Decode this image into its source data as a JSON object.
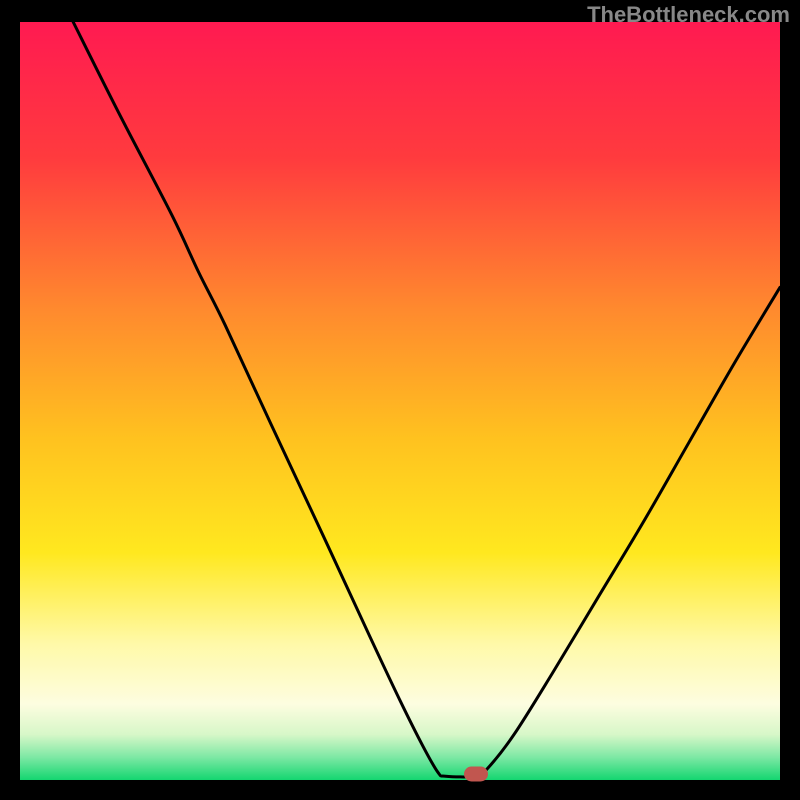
{
  "watermark": "TheBottleneck.com",
  "chart_data": {
    "type": "line",
    "title": "",
    "xlabel": "",
    "ylabel": "",
    "xlim": [
      0,
      100
    ],
    "ylim": [
      0,
      100
    ],
    "gradient_stops": [
      {
        "offset": 0,
        "color": "#ff1a51"
      },
      {
        "offset": 18,
        "color": "#ff3b3e"
      },
      {
        "offset": 38,
        "color": "#ff8a2e"
      },
      {
        "offset": 55,
        "color": "#ffc21f"
      },
      {
        "offset": 70,
        "color": "#ffe81f"
      },
      {
        "offset": 82,
        "color": "#fff9a8"
      },
      {
        "offset": 90,
        "color": "#fdfde0"
      },
      {
        "offset": 94,
        "color": "#d7f7c8"
      },
      {
        "offset": 97,
        "color": "#7de8a4"
      },
      {
        "offset": 100,
        "color": "#14d670"
      }
    ],
    "series": [
      {
        "name": "bottleneck-curve",
        "points": [
          {
            "x": 7.0,
            "y": 100.0
          },
          {
            "x": 13.0,
            "y": 88.0
          },
          {
            "x": 20.0,
            "y": 74.5
          },
          {
            "x": 23.5,
            "y": 67.0
          },
          {
            "x": 27.0,
            "y": 60.0
          },
          {
            "x": 33.0,
            "y": 47.0
          },
          {
            "x": 40.0,
            "y": 32.0
          },
          {
            "x": 46.0,
            "y": 19.0
          },
          {
            "x": 50.0,
            "y": 10.5
          },
          {
            "x": 53.0,
            "y": 4.5
          },
          {
            "x": 55.0,
            "y": 1.0
          },
          {
            "x": 56.0,
            "y": 0.5
          },
          {
            "x": 60.0,
            "y": 0.5
          },
          {
            "x": 61.5,
            "y": 1.5
          },
          {
            "x": 65.0,
            "y": 6.0
          },
          {
            "x": 70.0,
            "y": 14.0
          },
          {
            "x": 76.0,
            "y": 24.0
          },
          {
            "x": 82.0,
            "y": 34.0
          },
          {
            "x": 88.0,
            "y": 44.5
          },
          {
            "x": 94.0,
            "y": 55.0
          },
          {
            "x": 100.0,
            "y": 65.0
          }
        ]
      }
    ],
    "marker": {
      "x": 60.0,
      "y": 0.8,
      "color": "#c1564f"
    }
  }
}
